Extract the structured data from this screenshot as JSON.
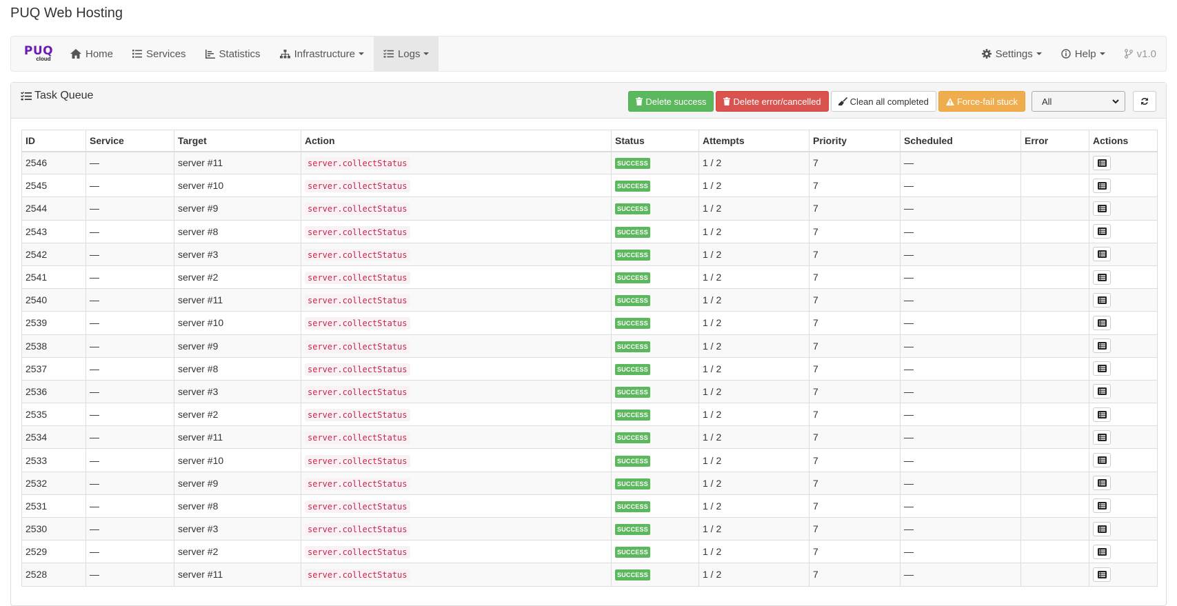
{
  "app": {
    "title": "PUQ Web Hosting"
  },
  "navbar": {
    "brand": {
      "line1": "PUQ",
      "line2": "cloud"
    },
    "items": [
      {
        "label": "Home",
        "icon": "home-icon",
        "dropdown": false,
        "active": false
      },
      {
        "label": "Services",
        "icon": "list-icon",
        "dropdown": false,
        "active": false
      },
      {
        "label": "Statistics",
        "icon": "chart-icon",
        "dropdown": false,
        "active": false
      },
      {
        "label": "Infrastructure",
        "icon": "sitemap-icon",
        "dropdown": true,
        "active": false
      },
      {
        "label": "Logs",
        "icon": "tasks-icon",
        "dropdown": true,
        "active": true
      }
    ],
    "right": {
      "settings": "Settings",
      "help": "Help",
      "version": "v1.0"
    }
  },
  "panel": {
    "title": "Task Queue",
    "toolbar": {
      "delete_success": "Delete success",
      "delete_error": "Delete error/cancelled",
      "clean_completed": "Clean all completed",
      "force_fail": "Force-fail stuck",
      "filter_value": "All"
    }
  },
  "colors": {
    "success": "#5cb85c",
    "danger": "#d9534f",
    "warning": "#f0ad4e",
    "code": "#c7254e",
    "brand": "#6a1bb8"
  },
  "table": {
    "columns": [
      "ID",
      "Service",
      "Target",
      "Action",
      "Status",
      "Attempts",
      "Priority",
      "Scheduled",
      "Error",
      "Actions"
    ],
    "rows": [
      {
        "id": "2546",
        "service": "—",
        "target": "server #11",
        "action": "server.collectStatus",
        "status": "SUCCESS",
        "attempts": "1 / 2",
        "priority": "7",
        "scheduled": "—",
        "error": ""
      },
      {
        "id": "2545",
        "service": "—",
        "target": "server #10",
        "action": "server.collectStatus",
        "status": "SUCCESS",
        "attempts": "1 / 2",
        "priority": "7",
        "scheduled": "—",
        "error": ""
      },
      {
        "id": "2544",
        "service": "—",
        "target": "server #9",
        "action": "server.collectStatus",
        "status": "SUCCESS",
        "attempts": "1 / 2",
        "priority": "7",
        "scheduled": "—",
        "error": ""
      },
      {
        "id": "2543",
        "service": "—",
        "target": "server #8",
        "action": "server.collectStatus",
        "status": "SUCCESS",
        "attempts": "1 / 2",
        "priority": "7",
        "scheduled": "—",
        "error": ""
      },
      {
        "id": "2542",
        "service": "—",
        "target": "server #3",
        "action": "server.collectStatus",
        "status": "SUCCESS",
        "attempts": "1 / 2",
        "priority": "7",
        "scheduled": "—",
        "error": ""
      },
      {
        "id": "2541",
        "service": "—",
        "target": "server #2",
        "action": "server.collectStatus",
        "status": "SUCCESS",
        "attempts": "1 / 2",
        "priority": "7",
        "scheduled": "—",
        "error": ""
      },
      {
        "id": "2540",
        "service": "—",
        "target": "server #11",
        "action": "server.collectStatus",
        "status": "SUCCESS",
        "attempts": "1 / 2",
        "priority": "7",
        "scheduled": "—",
        "error": ""
      },
      {
        "id": "2539",
        "service": "—",
        "target": "server #10",
        "action": "server.collectStatus",
        "status": "SUCCESS",
        "attempts": "1 / 2",
        "priority": "7",
        "scheduled": "—",
        "error": ""
      },
      {
        "id": "2538",
        "service": "—",
        "target": "server #9",
        "action": "server.collectStatus",
        "status": "SUCCESS",
        "attempts": "1 / 2",
        "priority": "7",
        "scheduled": "—",
        "error": ""
      },
      {
        "id": "2537",
        "service": "—",
        "target": "server #8",
        "action": "server.collectStatus",
        "status": "SUCCESS",
        "attempts": "1 / 2",
        "priority": "7",
        "scheduled": "—",
        "error": ""
      },
      {
        "id": "2536",
        "service": "—",
        "target": "server #3",
        "action": "server.collectStatus",
        "status": "SUCCESS",
        "attempts": "1 / 2",
        "priority": "7",
        "scheduled": "—",
        "error": ""
      },
      {
        "id": "2535",
        "service": "—",
        "target": "server #2",
        "action": "server.collectStatus",
        "status": "SUCCESS",
        "attempts": "1 / 2",
        "priority": "7",
        "scheduled": "—",
        "error": ""
      },
      {
        "id": "2534",
        "service": "—",
        "target": "server #11",
        "action": "server.collectStatus",
        "status": "SUCCESS",
        "attempts": "1 / 2",
        "priority": "7",
        "scheduled": "—",
        "error": ""
      },
      {
        "id": "2533",
        "service": "—",
        "target": "server #10",
        "action": "server.collectStatus",
        "status": "SUCCESS",
        "attempts": "1 / 2",
        "priority": "7",
        "scheduled": "—",
        "error": ""
      },
      {
        "id": "2532",
        "service": "—",
        "target": "server #9",
        "action": "server.collectStatus",
        "status": "SUCCESS",
        "attempts": "1 / 2",
        "priority": "7",
        "scheduled": "—",
        "error": ""
      },
      {
        "id": "2531",
        "service": "—",
        "target": "server #8",
        "action": "server.collectStatus",
        "status": "SUCCESS",
        "attempts": "1 / 2",
        "priority": "7",
        "scheduled": "—",
        "error": ""
      },
      {
        "id": "2530",
        "service": "—",
        "target": "server #3",
        "action": "server.collectStatus",
        "status": "SUCCESS",
        "attempts": "1 / 2",
        "priority": "7",
        "scheduled": "—",
        "error": ""
      },
      {
        "id": "2529",
        "service": "—",
        "target": "server #2",
        "action": "server.collectStatus",
        "status": "SUCCESS",
        "attempts": "1 / 2",
        "priority": "7",
        "scheduled": "—",
        "error": ""
      },
      {
        "id": "2528",
        "service": "—",
        "target": "server #11",
        "action": "server.collectStatus",
        "status": "SUCCESS",
        "attempts": "1 / 2",
        "priority": "7",
        "scheduled": "—",
        "error": ""
      }
    ]
  }
}
